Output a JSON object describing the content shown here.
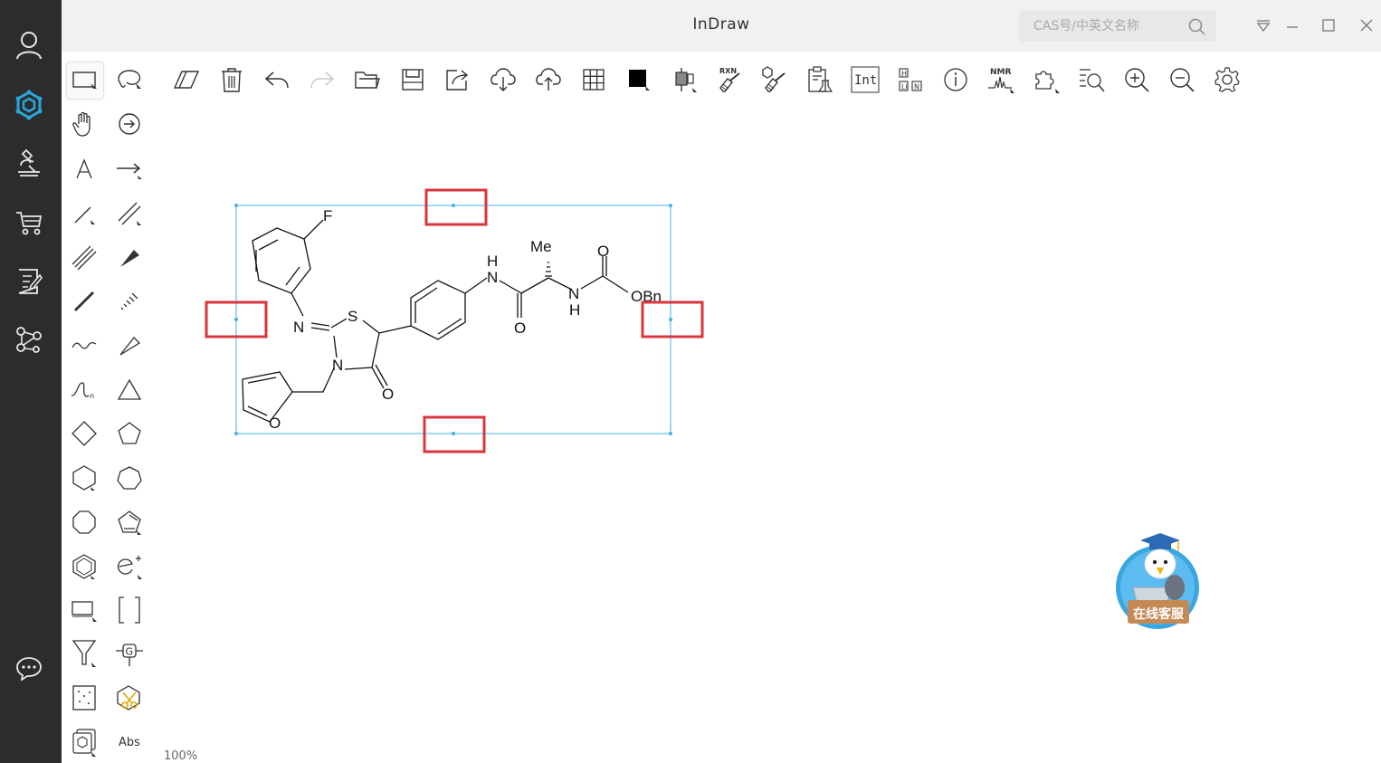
{
  "app": {
    "title": "InDraw"
  },
  "search": {
    "placeholder": "CAS号/中英文名称"
  },
  "nav": {
    "items": [
      {
        "name": "user-icon"
      },
      {
        "name": "structure-logo-icon",
        "active_color": "#2aa6dd"
      },
      {
        "name": "microscope-icon"
      },
      {
        "name": "cart-icon"
      },
      {
        "name": "notes-icon"
      },
      {
        "name": "network-icon"
      },
      {
        "name": "chat-icon"
      }
    ]
  },
  "palette": {
    "abs_label": "Abs"
  },
  "toolbar": {
    "rxn_label": "RXN",
    "int_label": "Int",
    "nmr_label": "NMR",
    "hlin_label": "H\nL N"
  },
  "molecule": {
    "atoms": [
      "F",
      "N",
      "S",
      "N",
      "O",
      "O",
      "H",
      "N",
      "O",
      "Me",
      "N",
      "H",
      "O",
      "OBn"
    ],
    "selection_color": "#4ab0e0",
    "highlight_color": "#d9363e"
  },
  "status": {
    "zoom": "100%"
  },
  "support": {
    "label": "在线客服"
  },
  "colors": {
    "nav_bg": "#2c2c2c",
    "accent": "#2aa6dd",
    "titlebar_bg": "#f1f1f1"
  }
}
